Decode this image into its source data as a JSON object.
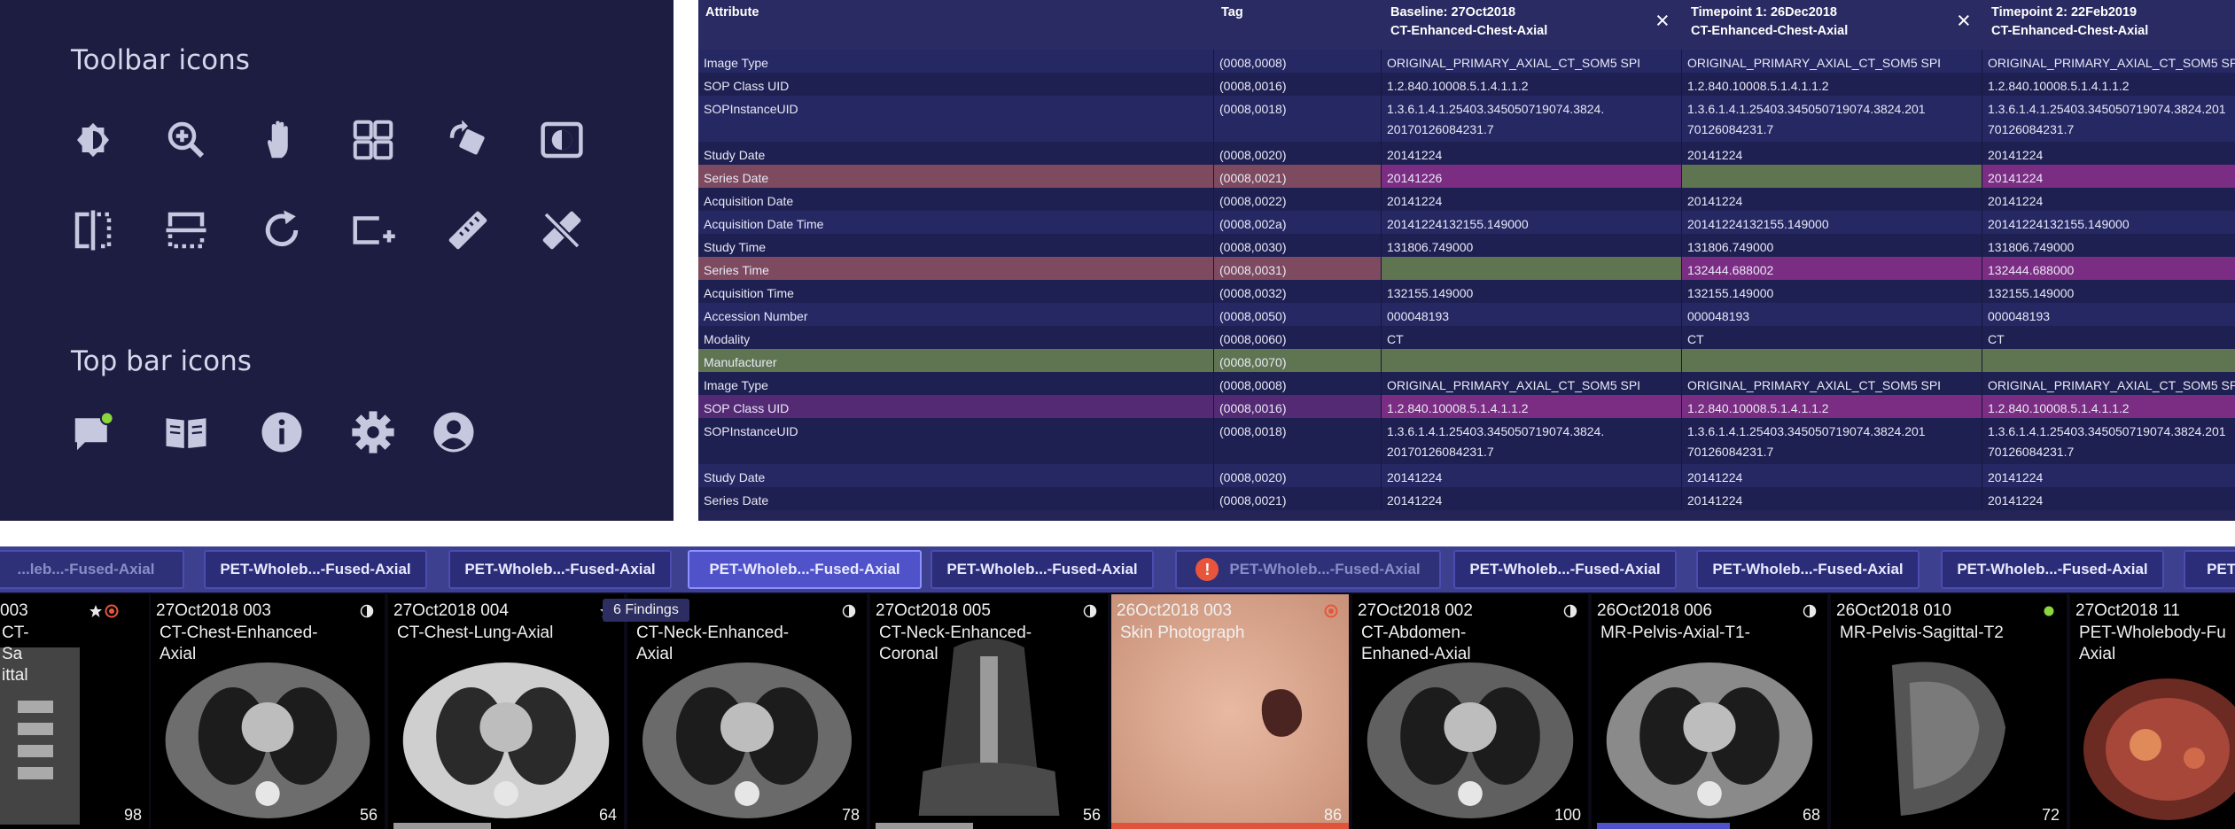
{
  "icon_panel": {
    "toolbar_title": "Toolbar icons",
    "toolbar_icons": [
      "contrast-icon",
      "zoom-in-icon",
      "pan-hand-icon",
      "layout-grid-icon",
      "rotate-icon",
      "invert-icon",
      "flip-horizontal-icon",
      "reference-lines-icon",
      "reset-icon",
      "add-rectangle-icon",
      "ruler-icon",
      "remove-measure-icon"
    ],
    "topbar_title": "Top bar icons",
    "topbar_icons": [
      "chat-notification-icon",
      "book-icon",
      "info-icon",
      "settings-icon",
      "user-account-icon"
    ]
  },
  "table": {
    "headers": [
      {
        "line1": "Attribute",
        "line2": ""
      },
      {
        "line1": "Tag",
        "line2": ""
      },
      {
        "line1": "Baseline: 27Oct2018",
        "line2": "CT-Enhanced-Chest-Axial"
      },
      {
        "line1": "Timepoint 1: 26Dec2018",
        "line2": "CT-Enhanced-Chest-Axial"
      },
      {
        "line1": "Timepoint 2: 22Feb2019",
        "line2": "CT-Enhanced-Chest-Axial"
      }
    ],
    "close_symbol": "×",
    "rows": [
      {
        "attr": "Image Type",
        "tag": "(0008,0008)",
        "v1": "ORIGINAL_PRIMARY_AXIAL_CT_SOM5 SPI",
        "v1b": "",
        "v2": "ORIGINAL_PRIMARY_AXIAL_CT_SOM5 SPI",
        "v2b": "",
        "v3": "ORIGINAL_PRIMARY_AXIAL_CT_SOM5 SPI",
        "v3b": ""
      },
      {
        "attr": "SOP Class UID",
        "tag": "(0008,0016)",
        "v1": "1.2.840.10008.5.1.4.1.1.2",
        "v1b": "",
        "v2": "1.2.840.10008.5.1.4.1.1.2",
        "v2b": "",
        "v3": "1.2.840.10008.5.1.4.1.1.2",
        "v3b": ""
      },
      {
        "attr": "SOPInstanceUID",
        "tag": "(0008,0018)",
        "v1": "1.3.6.1.4.1.25403.345050719074.3824.",
        "v1b": "20170126084231.7",
        "v2": "1.3.6.1.4.1.25403.345050719074.3824.201",
        "v2b": "70126084231.7",
        "v3": "1.3.6.1.4.1.25403.345050719074.3824.201",
        "v3b": "70126084231.7"
      },
      {
        "attr": "Study Date",
        "tag": "(0008,0020)",
        "v1": "20141224",
        "v1b": "",
        "v2": "20141224",
        "v2b": "",
        "v3": "20141224",
        "v3b": ""
      },
      {
        "attr": "Series Date",
        "tag": "(0008,0021)",
        "v1": "20141226",
        "v1b": "",
        "v2": "",
        "v2b": "",
        "v3": "20141224",
        "v3b": ""
      },
      {
        "attr": "Acquisition Date",
        "tag": "(0008,0022)",
        "v1": "20141224",
        "v1b": "",
        "v2": "20141224",
        "v2b": "",
        "v3": "20141224",
        "v3b": ""
      },
      {
        "attr": "Acquisition Date Time",
        "tag": "(0008,002a)",
        "v1": "20141224132155.149000",
        "v1b": "",
        "v2": "20141224132155.149000",
        "v2b": "",
        "v3": "20141224132155.149000",
        "v3b": ""
      },
      {
        "attr": "Study Time",
        "tag": "(0008,0030)",
        "v1": "131806.749000",
        "v1b": "",
        "v2": "131806.749000",
        "v2b": "",
        "v3": "131806.749000",
        "v3b": ""
      },
      {
        "attr": "Series Time",
        "tag": "(0008,0031)",
        "v1": "",
        "v1b": "",
        "v2": "132444.688002",
        "v2b": "",
        "v3": "132444.688000",
        "v3b": ""
      },
      {
        "attr": "Acquisition Time",
        "tag": "(0008,0032)",
        "v1": "132155.149000",
        "v1b": "",
        "v2": "132155.149000",
        "v2b": "",
        "v3": "132155.149000",
        "v3b": ""
      },
      {
        "attr": "Accession Number",
        "tag": "(0008,0050)",
        "v1": "000048193",
        "v1b": "",
        "v2": "000048193",
        "v2b": "",
        "v3": "000048193",
        "v3b": ""
      },
      {
        "attr": "Modality",
        "tag": "(0008,0060)",
        "v1": "CT",
        "v1b": "",
        "v2": "CT",
        "v2b": "",
        "v3": "CT",
        "v3b": ""
      },
      {
        "attr": "Manufacturer",
        "tag": "(0008,0070)",
        "v1": "",
        "v1b": "",
        "v2": "",
        "v2b": "",
        "v3": "",
        "v3b": ""
      },
      {
        "attr": "Image Type",
        "tag": "(0008,0008)",
        "v1": "ORIGINAL_PRIMARY_AXIAL_CT_SOM5 SPI",
        "v1b": "",
        "v2": "ORIGINAL_PRIMARY_AXIAL_CT_SOM5 SPI",
        "v2b": "",
        "v3": "ORIGINAL_PRIMARY_AXIAL_CT_SOM5 SPI",
        "v3b": ""
      },
      {
        "attr": "SOP Class UID",
        "tag": "(0008,0016)",
        "v1": "1.2.840.10008.5.1.4.1.1.2",
        "v1b": "",
        "v2": "1.2.840.10008.5.1.4.1.1.2",
        "v2b": "",
        "v3": "1.2.840.10008.5.1.4.1.1.2",
        "v3b": ""
      },
      {
        "attr": "SOPInstanceUID",
        "tag": "(0008,0018)",
        "v1": "1.3.6.1.4.1.25403.345050719074.3824.",
        "v1b": "20170126084231.7",
        "v2": "1.3.6.1.4.1.25403.345050719074.3824.201",
        "v2b": "70126084231.7",
        "v3": "1.3.6.1.4.1.25403.345050719074.3824.201",
        "v3b": "70126084231.7"
      },
      {
        "attr": "Study Date",
        "tag": "(0008,0020)",
        "v1": "20141224",
        "v1b": "",
        "v2": "20141224",
        "v2b": "",
        "v3": "20141224",
        "v3b": ""
      },
      {
        "attr": "Series Date",
        "tag": "(0008,0021)",
        "v1": "20141224",
        "v1b": "",
        "v2": "20141224",
        "v2b": "",
        "v3": "20141224",
        "v3b": ""
      }
    ]
  },
  "series_tabs": [
    {
      "label": "...leb...-Fused-Axial",
      "state": "dim"
    },
    {
      "label": "PET-Wholeb...-Fused-Axial",
      "state": "normal"
    },
    {
      "label": "PET-Wholeb...-Fused-Axial",
      "state": "normal"
    },
    {
      "label": "PET-Wholeb...-Fused-Axial",
      "state": "active"
    },
    {
      "label": "PET-Wholeb...-Fused-Axial",
      "state": "normal"
    },
    {
      "label": "PET-Wholeb...-Fused-Axial",
      "state": "error",
      "icon": "!"
    },
    {
      "label": "PET-Wholeb...-Fused-Axial",
      "state": "normal"
    },
    {
      "label": "PET-Wholeb...-Fused-Axial",
      "state": "normal"
    },
    {
      "label": "PET-Wholeb...-Fused-Axial",
      "state": "normal"
    },
    {
      "label": "PET-",
      "state": "normal"
    }
  ],
  "thumbnails": [
    {
      "date": "003",
      "desc": "CT-\nSa\nittal",
      "count": "98",
      "status": "star"
    },
    {
      "date": "27Oct2018 003",
      "desc": "CT-Chest-Enhanced-\nAxial",
      "count": "56",
      "status": "half"
    },
    {
      "date": "27Oct2018 004",
      "desc": "CT-Chest-Lung-Axial",
      "count": "64",
      "status": "star"
    },
    {
      "date": "8 002",
      "desc": "CT-Neck-Enhanced-\nAxial",
      "count": "78",
      "status": "half"
    },
    {
      "date": "27Oct2018 005",
      "desc": "CT-Neck-Enhanced-\nCoronal",
      "count": "56",
      "status": "half"
    },
    {
      "date": "26Oct2018 003",
      "desc": "Skin Photograph",
      "count": "86",
      "status": "error"
    },
    {
      "date": "27Oct2018 002",
      "desc": "CT-Abdomen-\nEnhaned-Axial",
      "count": "100",
      "status": "half"
    },
    {
      "date": "26Oct2018 006",
      "desc": "MR-Pelvis-Axial-T1-",
      "count": "68",
      "status": "half"
    },
    {
      "date": "26Oct2018 010",
      "desc": "MR-Pelvis-Sagittal-T2",
      "count": "72",
      "status": "ok"
    },
    {
      "date": "27Oct2018 11",
      "desc": "PET-Wholebody-Fu\nAxial",
      "count": "",
      "status": "none"
    }
  ],
  "findings_tooltip": "6 Findings",
  "colors": {
    "panel_bg": "#1d1d42",
    "table_bg": "#242556",
    "mismatch_purple": "#7a2d82",
    "match_green": "#5f7552",
    "error_red": "#e8553b",
    "ok_green": "#8bd63c",
    "active_tab": "#4f52c8"
  }
}
